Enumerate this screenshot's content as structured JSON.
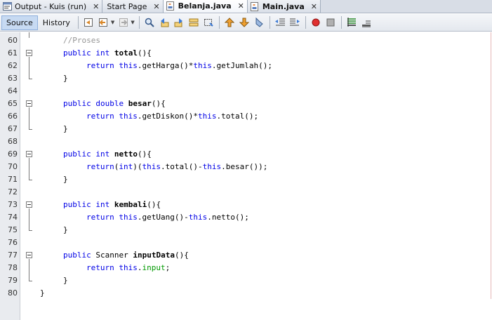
{
  "tabs": [
    {
      "label": "Output - Kuis (run)",
      "icon": "output-icon",
      "active": false
    },
    {
      "label": "Start Page",
      "icon": "none",
      "active": false
    },
    {
      "label": "Belanja.java",
      "icon": "java-file-icon",
      "active": true
    },
    {
      "label": "Main.java",
      "icon": "java-file-icon",
      "active": false
    }
  ],
  "close_glyph": "✕",
  "toolbar": {
    "source_label": "Source",
    "history_label": "History"
  },
  "colors": {
    "keyword": "#0000e6",
    "comment": "#969696",
    "field": "#009900"
  },
  "lines": [
    {
      "num": "60",
      "tokens": [
        [
          "cm",
          "//Proses"
        ]
      ],
      "indent": 1
    },
    {
      "num": "61",
      "tokens": [
        [
          "kw",
          "public"
        ],
        [
          "t",
          " "
        ],
        [
          "kw",
          "int"
        ],
        [
          "t",
          " "
        ],
        [
          "fn",
          "total"
        ],
        [
          "t",
          "(){"
        ]
      ],
      "indent": 1
    },
    {
      "num": "62",
      "tokens": [
        [
          "kw",
          "return"
        ],
        [
          "t",
          " "
        ],
        [
          "kw",
          "this"
        ],
        [
          "t",
          ".getHarga()*"
        ],
        [
          "kw",
          "this"
        ],
        [
          "t",
          ".getJumlah();"
        ]
      ],
      "indent": 2
    },
    {
      "num": "63",
      "tokens": [
        [
          "t",
          "}"
        ]
      ],
      "indent": 1
    },
    {
      "num": "64",
      "tokens": [],
      "indent": 0
    },
    {
      "num": "65",
      "tokens": [
        [
          "kw",
          "public"
        ],
        [
          "t",
          " "
        ],
        [
          "kw",
          "double"
        ],
        [
          "t",
          " "
        ],
        [
          "fn",
          "besar"
        ],
        [
          "t",
          "(){"
        ]
      ],
      "indent": 1
    },
    {
      "num": "66",
      "tokens": [
        [
          "kw",
          "return"
        ],
        [
          "t",
          " "
        ],
        [
          "kw",
          "this"
        ],
        [
          "t",
          ".getDiskon()*"
        ],
        [
          "kw",
          "this"
        ],
        [
          "t",
          ".total();"
        ]
      ],
      "indent": 2
    },
    {
      "num": "67",
      "tokens": [
        [
          "t",
          "}"
        ]
      ],
      "indent": 1
    },
    {
      "num": "68",
      "tokens": [],
      "indent": 0
    },
    {
      "num": "69",
      "tokens": [
        [
          "kw",
          "public"
        ],
        [
          "t",
          " "
        ],
        [
          "kw",
          "int"
        ],
        [
          "t",
          " "
        ],
        [
          "fn",
          "netto"
        ],
        [
          "t",
          "(){"
        ]
      ],
      "indent": 1
    },
    {
      "num": "70",
      "tokens": [
        [
          "kw",
          "return"
        ],
        [
          "t",
          "("
        ],
        [
          "kw",
          "int"
        ],
        [
          "t",
          ")("
        ],
        [
          "kw",
          "this"
        ],
        [
          "t",
          ".total()-"
        ],
        [
          "kw",
          "this"
        ],
        [
          "t",
          ".besar());"
        ]
      ],
      "indent": 2
    },
    {
      "num": "71",
      "tokens": [
        [
          "t",
          "}"
        ]
      ],
      "indent": 1
    },
    {
      "num": "72",
      "tokens": [],
      "indent": 0
    },
    {
      "num": "73",
      "tokens": [
        [
          "kw",
          "public"
        ],
        [
          "t",
          " "
        ],
        [
          "kw",
          "int"
        ],
        [
          "t",
          " "
        ],
        [
          "fn",
          "kembali"
        ],
        [
          "t",
          "(){"
        ]
      ],
      "indent": 1
    },
    {
      "num": "74",
      "tokens": [
        [
          "kw",
          "return"
        ],
        [
          "t",
          " "
        ],
        [
          "kw",
          "this"
        ],
        [
          "t",
          ".getUang()-"
        ],
        [
          "kw",
          "this"
        ],
        [
          "t",
          ".netto();"
        ]
      ],
      "indent": 2
    },
    {
      "num": "75",
      "tokens": [
        [
          "t",
          "}"
        ]
      ],
      "indent": 1
    },
    {
      "num": "76",
      "tokens": [],
      "indent": 0
    },
    {
      "num": "77",
      "tokens": [
        [
          "kw",
          "public"
        ],
        [
          "t",
          " Scanner "
        ],
        [
          "fn",
          "inputData"
        ],
        [
          "t",
          "(){"
        ]
      ],
      "indent": 1
    },
    {
      "num": "78",
      "tokens": [
        [
          "kw",
          "return"
        ],
        [
          "t",
          " "
        ],
        [
          "kw",
          "this"
        ],
        [
          "t",
          "."
        ],
        [
          "fld",
          "input"
        ],
        [
          "t",
          ";"
        ]
      ],
      "indent": 2
    },
    {
      "num": "79",
      "tokens": [
        [
          "t",
          "}"
        ]
      ],
      "indent": 1
    },
    {
      "num": "80",
      "tokens": [
        [
          "t",
          "}"
        ]
      ],
      "indent": 0
    }
  ]
}
